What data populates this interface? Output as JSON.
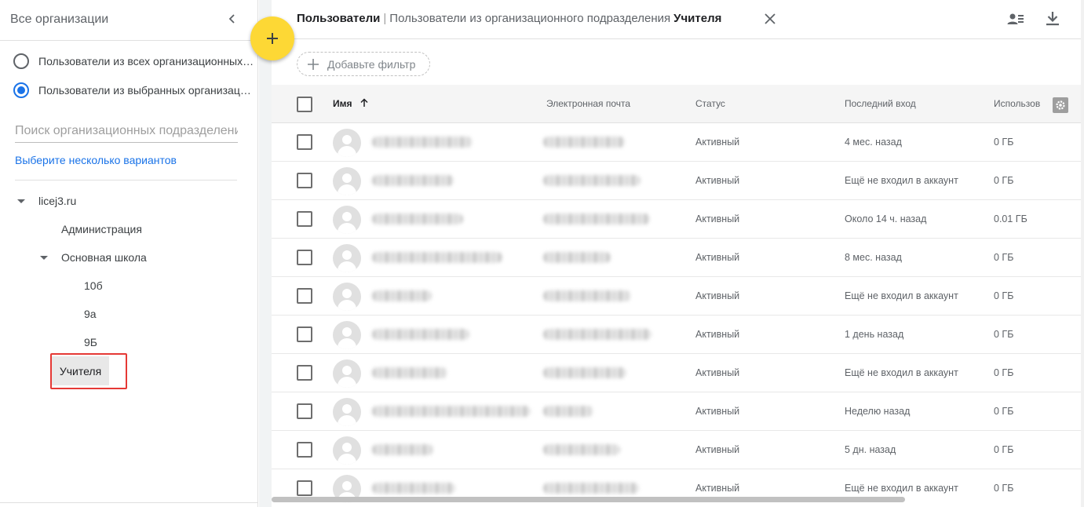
{
  "sidebar": {
    "title": "Все организации",
    "options": [
      {
        "label": "Пользователи из всех организационных подразделений",
        "selected": false
      },
      {
        "label": "Пользователи из выбранных организационных подразделений",
        "selected": true
      }
    ],
    "search_placeholder": "Поиск организационных подразделений",
    "multi_select_label": "Выберите несколько вариантов",
    "tree": {
      "root": "licej3.ru",
      "administration": "Администрация",
      "main_school": "Основная школа",
      "class_10b": "10б",
      "class_9a": "9а",
      "class_9b": "9Б",
      "teachers": "Учителя"
    }
  },
  "header": {
    "root": "Пользователи",
    "separator": "|",
    "description": "Пользователи из организационного подразделения",
    "unit": "Учителя"
  },
  "filter": {
    "label": "Добавьте фильтр"
  },
  "table": {
    "columns": {
      "name": "Имя",
      "email": "Электронная почта",
      "status": "Статус",
      "last_login": "Последний вход",
      "usage": "Использов"
    },
    "sort": {
      "column": "name",
      "direction": "ascending"
    },
    "rows": [
      {
        "status": "Активный",
        "last_login": "4 мес. назад",
        "usage": "0 ГБ"
      },
      {
        "status": "Активный",
        "last_login": "Ещё не входил в аккаунт",
        "usage": "0 ГБ"
      },
      {
        "status": "Активный",
        "last_login": "Около 14 ч. назад",
        "usage": "0.01 ГБ"
      },
      {
        "status": "Активный",
        "last_login": "8 мес. назад",
        "usage": "0 ГБ"
      },
      {
        "status": "Активный",
        "last_login": "Ещё не входил в аккаунт",
        "usage": "0 ГБ"
      },
      {
        "status": "Активный",
        "last_login": "1 день назад",
        "usage": "0 ГБ"
      },
      {
        "status": "Активный",
        "last_login": "Ещё не входил в аккаунт",
        "usage": "0 ГБ"
      },
      {
        "status": "Активный",
        "last_login": "Неделю назад",
        "usage": "0 ГБ"
      },
      {
        "status": "Активный",
        "last_login": "5 дн. назад",
        "usage": "0 ГБ"
      },
      {
        "status": "Активный",
        "last_login": "Ещё не входил в аккаунт",
        "usage": "0 ГБ"
      }
    ]
  },
  "icons": {
    "collapse": "chevron-left-icon",
    "fab": "plus-icon",
    "close": "close-icon",
    "manage": "manage-users-icon",
    "download": "download-icon",
    "column_settings": "gear-icon"
  },
  "colors": {
    "accent": "#1a73e8",
    "fab": "#fdd835",
    "highlight": "#e53935"
  }
}
